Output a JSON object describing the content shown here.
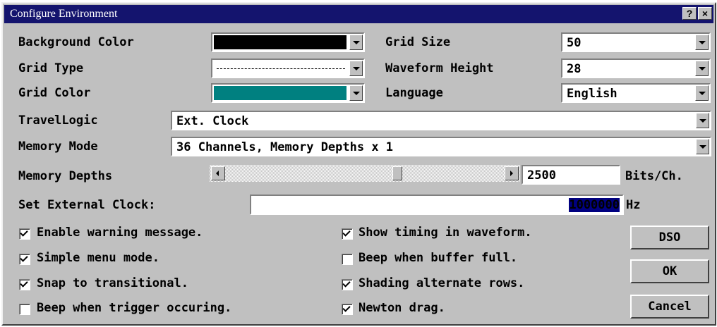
{
  "window": {
    "title": "Configure Environment",
    "help_label": "?",
    "close_label": "×"
  },
  "background_color": {
    "label": "Background Color",
    "color": "#000000"
  },
  "grid_type": {
    "label": "Grid Type",
    "value": "dashed"
  },
  "grid_color": {
    "label": "Grid Color",
    "color": "#008080"
  },
  "grid_size": {
    "label": "Grid Size",
    "value": "50"
  },
  "waveform_height": {
    "label": "Waveform Height",
    "value": "28"
  },
  "language": {
    "label": "Language",
    "value": "English"
  },
  "travel_logic": {
    "label": "TravelLogic",
    "value": "Ext. Clock"
  },
  "memory_mode": {
    "label": "Memory Mode",
    "value": "36 Channels, Memory Depths x 1"
  },
  "memory_depths": {
    "label": "Memory Depths",
    "value": "2500",
    "unit": "Bits/Ch.",
    "slider_position": 0.62
  },
  "external_clock": {
    "label": "Set External Clock:",
    "value": "1000000",
    "unit": "Hz"
  },
  "checkboxes": [
    {
      "label": "Enable warning message.",
      "checked": true
    },
    {
      "label": "Simple menu mode.",
      "checked": true
    },
    {
      "label": "Snap to transitional.",
      "checked": true
    },
    {
      "label": "Beep when trigger occuring.",
      "checked": false
    },
    {
      "label": "Show timing in waveform.",
      "checked": true
    },
    {
      "label": "Beep when buffer full.",
      "checked": false
    },
    {
      "label": "Shading alternate rows.",
      "checked": true
    },
    {
      "label": "Newton drag.",
      "checked": true
    }
  ],
  "buttons": {
    "dso": "DSO",
    "ok": "OK",
    "cancel": "Cancel"
  }
}
